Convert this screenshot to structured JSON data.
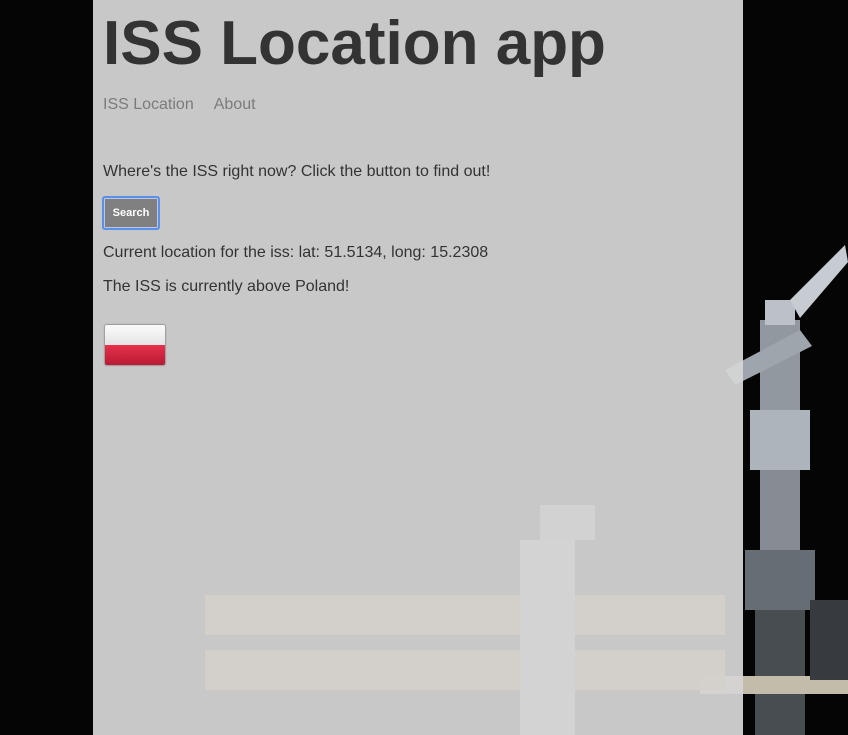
{
  "app": {
    "title": "ISS Location app"
  },
  "nav": {
    "items": [
      {
        "label": "ISS Location"
      },
      {
        "label": "About"
      }
    ]
  },
  "main": {
    "prompt": "Where's the ISS right now? Click the button to find out!",
    "search_label": "Search",
    "location_text": "Current location for the iss: lat: 51.5134, long: 15.2308",
    "country_text": "The ISS is currently above Poland!",
    "flag": {
      "country": "Poland",
      "colors": [
        "#ffffff",
        "#dc143c"
      ]
    }
  },
  "theme": {
    "panel_bg": "#d4d4d4",
    "title_color": "#333333",
    "nav_color": "#7b7b7b",
    "button_bg": "#808080",
    "focus_ring": "#5b8fe8",
    "space_bg": "#050505"
  }
}
